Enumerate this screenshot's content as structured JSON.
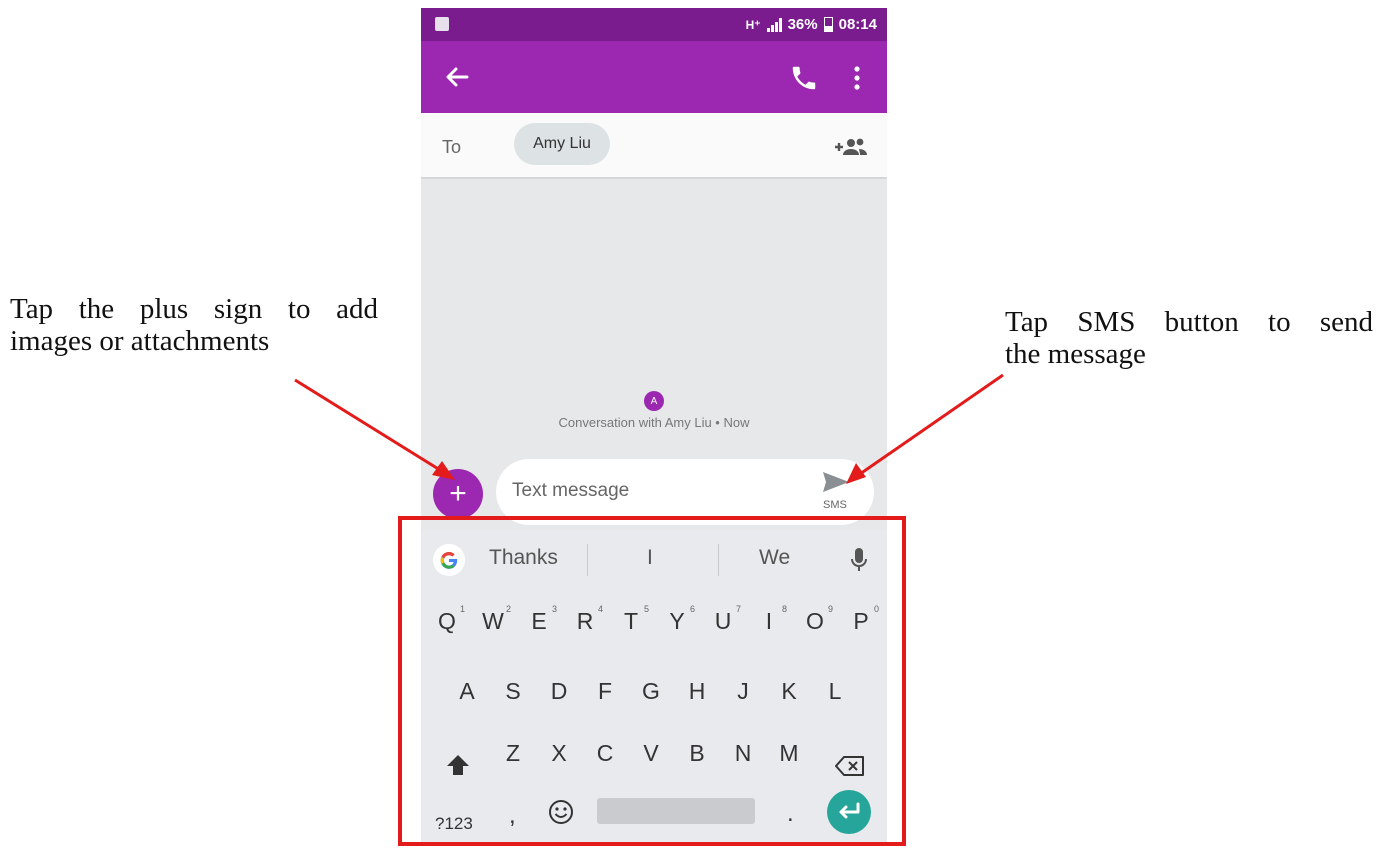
{
  "annotations": {
    "left_line1": "Tap the plus sign to add",
    "left_line2": "images or attachments",
    "right_line1": "Tap SMS button to send",
    "right_line2": "the message"
  },
  "status_bar": {
    "network": "H⁺",
    "battery_percent": "36%",
    "time": "08:14",
    "icons": [
      "image-notification-icon",
      "signal-icon",
      "battery-icon"
    ]
  },
  "app_bar": {
    "color": "#9c27b0",
    "icons": [
      "back-arrow-icon",
      "phone-icon",
      "more-vert-icon"
    ]
  },
  "recipient": {
    "to_label": "To",
    "chip_name": "Amy Liu"
  },
  "conversation": {
    "avatar_letter": "A",
    "info": "Conversation with Amy Liu • Now"
  },
  "compose": {
    "placeholder": "Text message",
    "send_label": "SMS"
  },
  "keyboard": {
    "suggestions": [
      "Thanks",
      "I",
      "We"
    ],
    "row1": [
      {
        "k": "Q",
        "n": "1"
      },
      {
        "k": "W",
        "n": "2"
      },
      {
        "k": "E",
        "n": "3"
      },
      {
        "k": "R",
        "n": "4"
      },
      {
        "k": "T",
        "n": "5"
      },
      {
        "k": "Y",
        "n": "6"
      },
      {
        "k": "U",
        "n": "7"
      },
      {
        "k": "I",
        "n": "8"
      },
      {
        "k": "O",
        "n": "9"
      },
      {
        "k": "P",
        "n": "0"
      }
    ],
    "row2": [
      "A",
      "S",
      "D",
      "F",
      "G",
      "H",
      "J",
      "K",
      "L"
    ],
    "row3": [
      "Z",
      "X",
      "C",
      "V",
      "B",
      "N",
      "M"
    ],
    "symbols_key": "?123",
    "comma": ",",
    "period": ".",
    "enter_color": "#26a69a"
  },
  "colors": {
    "accent": "#9c27b0",
    "status_bar": "#7a1c8e",
    "annotation_red": "#e31b1b"
  }
}
